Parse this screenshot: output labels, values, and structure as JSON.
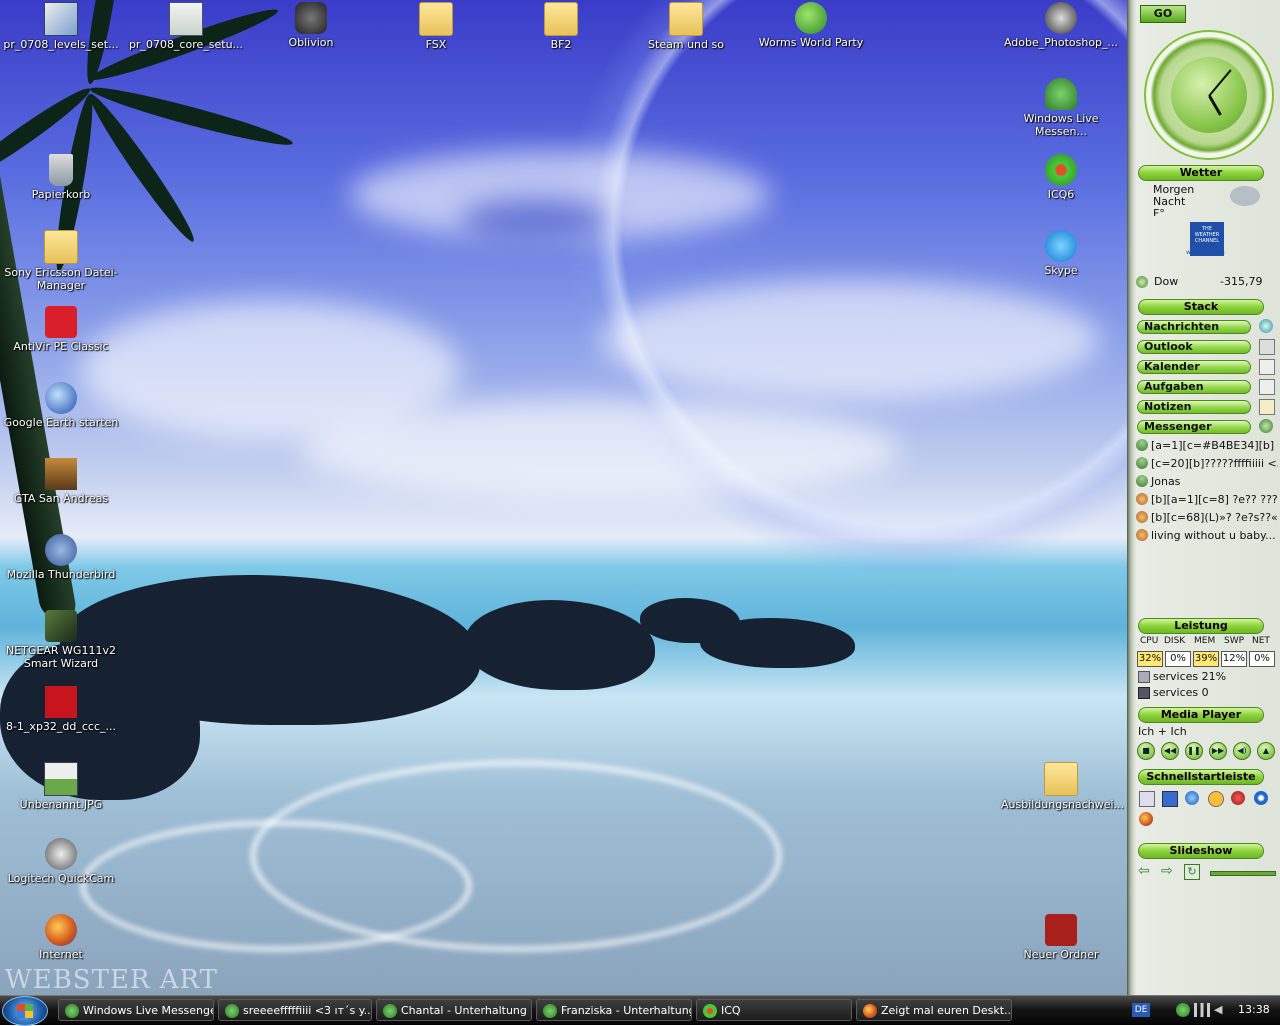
{
  "desktop": {
    "icons_top": [
      {
        "label": "pr_0708_levels_set..."
      },
      {
        "label": "pr_0708_core_setu..."
      },
      {
        "label": "Oblivion"
      },
      {
        "label": "FSX"
      },
      {
        "label": "BF2"
      },
      {
        "label": "Steam und so"
      },
      {
        "label": "Worms World Party"
      },
      {
        "label": "Adobe_Photoshop_..."
      }
    ],
    "icons_left": [
      {
        "label": "Papierkorb"
      },
      {
        "label": "Sony Ericsson Datei-Manager"
      },
      {
        "label": "AntiVir PE Classic"
      },
      {
        "label": "Google Earth starten"
      },
      {
        "label": "GTA San Andreas"
      },
      {
        "label": "Mozilla Thunderbird"
      },
      {
        "label": "NETGEAR WG111v2 Smart Wizard"
      },
      {
        "label": "8-1_xp32_dd_ccc_..."
      },
      {
        "label": "Unbenannt.JPG"
      },
      {
        "label": "Logitech QuickCam"
      },
      {
        "label": "Internet"
      }
    ],
    "icons_right": [
      {
        "label": "Windows Live Messen..."
      },
      {
        "label": "ICQ6"
      },
      {
        "label": "Skype"
      },
      {
        "label": "Ausbildungsnachwei..."
      },
      {
        "label": "Neuer Ordner"
      }
    ],
    "watermark": "WEBSTER ART"
  },
  "sidebar": {
    "go_label": "GO",
    "weather": {
      "title": "Wetter",
      "line1": "Morgen",
      "line2": "Nacht",
      "line3": "F°",
      "logo_line1": "THE",
      "logo_line2": "WEATHER",
      "logo_line3": "CHANNEL",
      "logo_url_text": "weather.com"
    },
    "stock": {
      "name": "Dow",
      "value": "-315,79"
    },
    "stack": {
      "title": "Stack",
      "items": [
        {
          "label": "Nachrichten"
        },
        {
          "label": "Outlook"
        },
        {
          "label": "Kalender"
        },
        {
          "label": "Aufgaben"
        },
        {
          "label": "Notizen"
        },
        {
          "label": "Messenger"
        }
      ]
    },
    "messenger_list": [
      {
        "text": "[a=1][c=#B4BE34][b] x-"
      },
      {
        "text": "[c=20][b]?????ffffiiiii <3 [/"
      },
      {
        "text": "Jonas"
      },
      {
        "text": "[b][a=1][c=8] ?e?? ???s?ta"
      },
      {
        "text": "[b][c=68](L)»? ?e?s??« ¤."
      },
      {
        "text": "living without u baby..."
      }
    ],
    "performance": {
      "title": "Leistung",
      "headers": [
        "CPU",
        "DISK",
        "MEM",
        "SWP",
        "NET"
      ],
      "values": [
        "32%",
        "0%",
        "39%",
        "12%",
        "0%"
      ],
      "proc1": "services 21%",
      "proc2": "services 0"
    },
    "media_player": {
      "title": "Media Player",
      "track": "Ich + Ich",
      "buttons": [
        "stop",
        "prev",
        "pause",
        "next",
        "volume",
        "eject"
      ]
    },
    "quicklaunch": {
      "title": "Schnellstartleiste"
    },
    "slideshow": {
      "title": "Slideshow"
    }
  },
  "taskbar": {
    "tasks": [
      {
        "label": "Windows Live Messenger"
      },
      {
        "label": "sreeeefffffiiii <3 ıт´s y..."
      },
      {
        "label": "Chantal - Unterhaltung"
      },
      {
        "label": "Franziska - Unterhaltung"
      },
      {
        "label": "ICQ"
      },
      {
        "label": "Zeigt mal euren Deskt..."
      }
    ],
    "lang": "DE",
    "clock": "13:38"
  },
  "colors": {
    "accent_green": "#8bd33a",
    "taskbar_dark": "#161616"
  }
}
